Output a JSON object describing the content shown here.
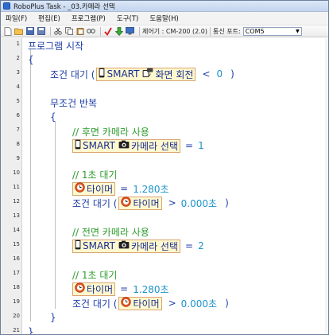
{
  "window": {
    "title": "RoboPlus Task - _03.카메라 선택"
  },
  "menu": {
    "items": [
      {
        "label": "파일(F)"
      },
      {
        "label": "편집(E)"
      },
      {
        "label": "프로그램(P)"
      },
      {
        "label": "도구(T)"
      },
      {
        "label": "도움말(H)"
      }
    ]
  },
  "toolbar": {
    "controller_label": "제어기 : CM-200 (2.0)",
    "port_label": "통신 포트:",
    "port_value": "COM5"
  },
  "icons": {
    "app": "app-icon",
    "new": "new-file-icon",
    "open": "open-folder-icon",
    "save": "save-icon",
    "saveas": "save-as-icon",
    "cut": "cut-icon",
    "copy": "copy-icon",
    "paste": "paste-icon",
    "find": "find-icon",
    "compile": "checkmark-icon",
    "download": "download-arrow-icon",
    "monitor": "monitor-icon",
    "phone": "smartphone-icon",
    "rotate": "screen-rotate-icon",
    "camera": "camera-icon",
    "timer": "timer-icon"
  },
  "editor": {
    "line_numbers": [
      "1",
      "2",
      "3",
      "4",
      "5",
      "6",
      "7",
      "8",
      "9",
      "10",
      "11",
      "12",
      "13",
      "14",
      "15",
      "16",
      "17",
      "18",
      "19",
      "20",
      "21",
      "22"
    ],
    "line1": "프로그램 시작",
    "line2": "{",
    "line3": {
      "prefix": "조건 대기 (",
      "smart": "SMART",
      "param": "화면 회전",
      "op": "<",
      "value": "0",
      "suffix": ")"
    },
    "line5": "무조건 반복",
    "line6": "{",
    "line7": "// 후면 카메라 사용",
    "line8": {
      "smart": "SMART",
      "param": "카메라 선택",
      "eq": "=",
      "value": "1"
    },
    "line10": "// 1초 대기",
    "line11": {
      "timer": "타이머",
      "eq": "=",
      "value": "1.280초"
    },
    "line12": {
      "prefix": "조건 대기 (",
      "timer": "타이머",
      "op": ">",
      "value": "0.000초",
      "suffix": ")"
    },
    "line14": "// 전면 카메라 사용",
    "line15": {
      "smart": "SMART",
      "param": "카메라 선택",
      "eq": "=",
      "value": "2"
    },
    "line17": "// 1초 대기",
    "line18": {
      "timer": "타이머",
      "eq": "=",
      "value": "1.280초"
    },
    "line19": {
      "prefix": "조건 대기 (",
      "timer": "타이머",
      "op": ">",
      "value": "0.000초",
      "suffix": ")"
    },
    "line20": "}",
    "line21": "}"
  }
}
